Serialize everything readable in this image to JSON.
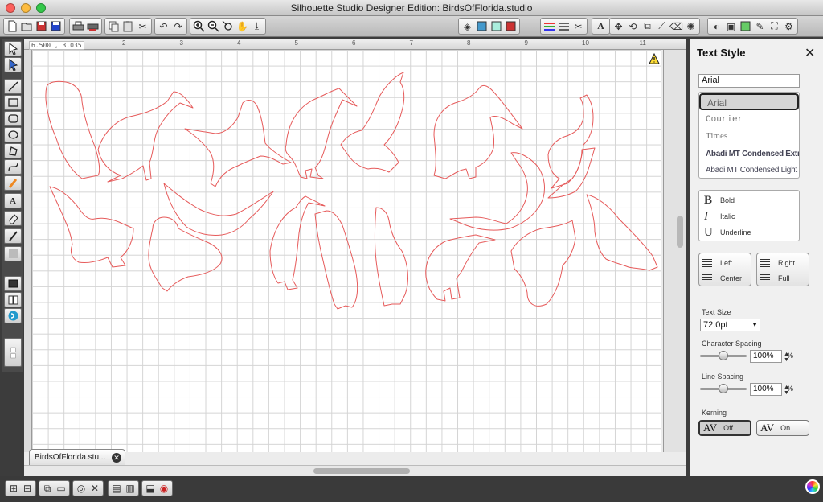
{
  "window": {
    "title": "Silhouette Studio Designer Edition: BirdsOfFlorida.studio"
  },
  "ruler": {
    "coordinates": "6.500 , 3.035",
    "top_ticks": [
      "2",
      "3",
      "4",
      "5",
      "6",
      "7",
      "8",
      "9",
      "10",
      "11"
    ]
  },
  "document": {
    "tab_label": "BirdsOfFlorida.stu...",
    "close_glyph": "✕"
  },
  "panel": {
    "title": "Text Style",
    "close_glyph": "✕",
    "font_input_value": "Arial",
    "fonts": [
      "Arial",
      "Courier",
      "Times",
      "Abadi MT Condensed Extra",
      "Abadi MT Condensed Light"
    ],
    "selected_font": "Arial",
    "styles": [
      {
        "glyph": "B",
        "label": "Bold"
      },
      {
        "glyph": "I",
        "label": "Italic"
      },
      {
        "glyph": "U",
        "label": "Underline"
      }
    ],
    "align": {
      "left": "Left",
      "right": "Right",
      "center": "Center",
      "full": "Full"
    },
    "text_size": {
      "label": "Text Size",
      "value": "72.0pt"
    },
    "character_spacing": {
      "label": "Character Spacing",
      "value": "100%",
      "unit": "%",
      "level": 0.5
    },
    "line_spacing": {
      "label": "Line Spacing",
      "value": "100%",
      "unit": "%",
      "level": 0.5
    },
    "kerning": {
      "label": "Kerning",
      "glyph": "AV",
      "off": "Off",
      "on": "On",
      "selected": "Off"
    }
  },
  "colors": {
    "cut_line": "#e65a5a",
    "grid": "#d4d4d4",
    "panel_bg": "#f0f0f0",
    "chrome": "#3c3c3c"
  }
}
